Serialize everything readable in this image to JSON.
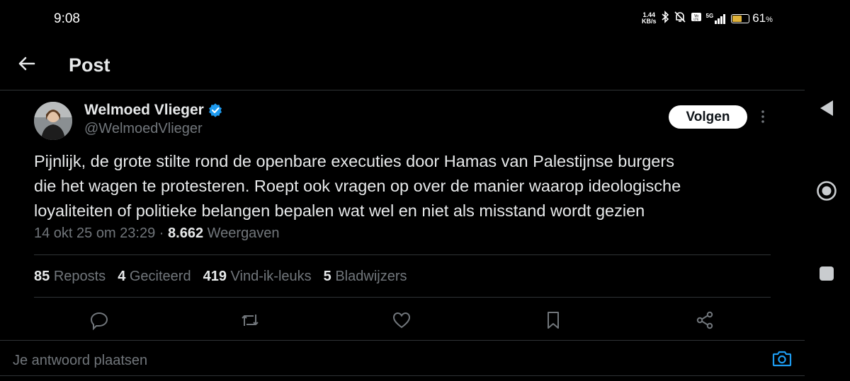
{
  "status_bar": {
    "time": "9:08",
    "net_speed_value": "1.44",
    "net_speed_unit": "KB/s",
    "network_type": "5G",
    "battery_percent": "61",
    "battery_suffix": "%",
    "battery_level": 0.61
  },
  "header": {
    "title": "Post",
    "back_icon": "arrow-left-icon"
  },
  "post": {
    "author": {
      "display_name": "Welmoed Vlieger",
      "handle": "@WelmoedVlieger",
      "verified": true,
      "verified_color": "#1d9bf0"
    },
    "follow_label": "Volgen",
    "text_lines": [
      "Pijnlijk, de grote stilte rond de openbare executies door Hamas van Palestijnse burgers",
      "die het wagen te protesteren. Roept ook vragen op over de manier waarop ideologische",
      "loyaliteiten of politieke belangen bepalen wat wel en niet als misstand wordt gezien"
    ],
    "timestamp": "14 okt 25 om 23:29",
    "separator": " · ",
    "views_count": "8.662",
    "views_label": "Weergaven",
    "stats": [
      {
        "count": "85",
        "label": "Reposts"
      },
      {
        "count": "4",
        "label": "Geciteerd"
      },
      {
        "count": "419",
        "label": "Vind-ik-leuks"
      },
      {
        "count": "5",
        "label": "Bladwijzers"
      }
    ],
    "actions": [
      "reply-icon",
      "repost-icon",
      "like-icon",
      "bookmark-icon",
      "share-icon"
    ]
  },
  "reply": {
    "placeholder": "Je antwoord plaatsen",
    "camera_icon": "camera-icon",
    "accent_color": "#1d9bf0"
  },
  "system_nav": [
    "back-triangle-icon",
    "home-circle-icon",
    "recents-square-icon"
  ],
  "colors": {
    "background": "#000000",
    "text_primary": "#e7e9ea",
    "text_secondary": "#71767b",
    "divider": "#2f3336",
    "accent": "#1d9bf0"
  }
}
